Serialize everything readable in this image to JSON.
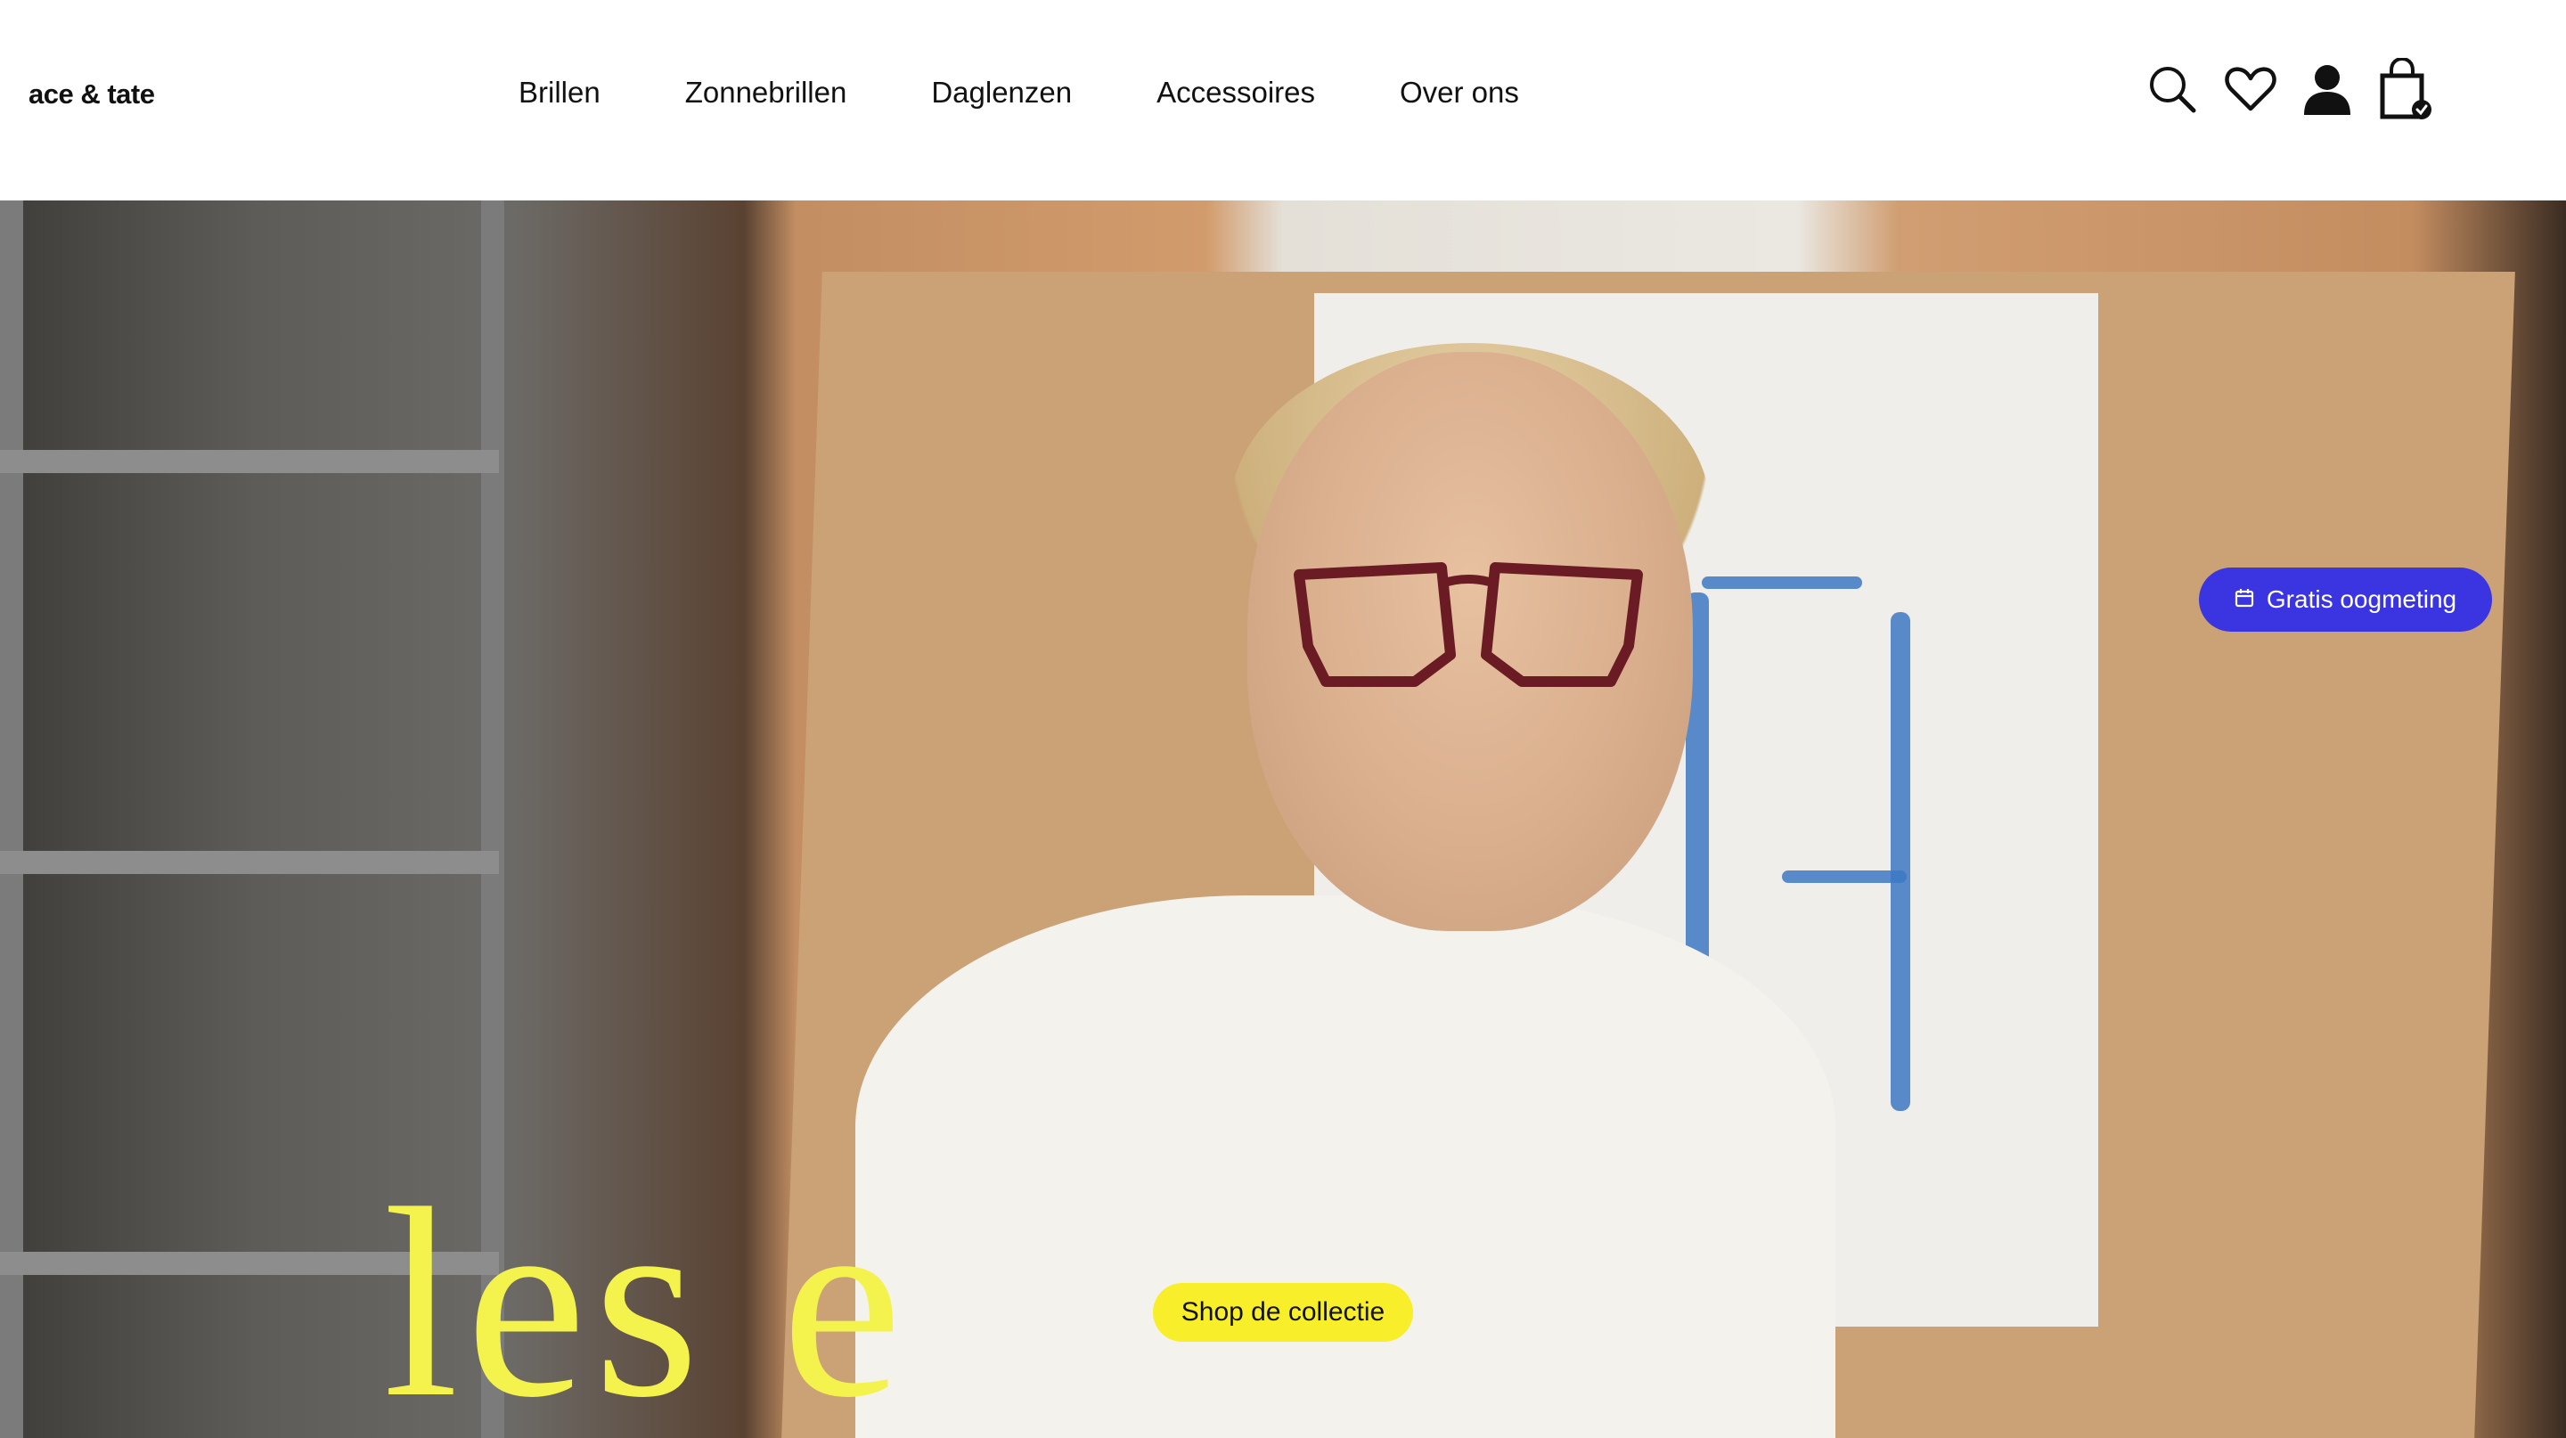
{
  "brand": {
    "logo_text": "ace & tate"
  },
  "nav": {
    "items": [
      "Brillen",
      "Zonnebrillen",
      "Daglenzen",
      "Accessoires",
      "Over ons"
    ]
  },
  "header_icons": [
    "search-icon",
    "heart-icon",
    "user-icon",
    "shopping-bag-icon"
  ],
  "hero": {
    "headline": "les e",
    "shop_button": "Shop de collectie",
    "appointment_button": "Gratis oogmeting",
    "appointment_icon": "calendar-icon"
  },
  "colors": {
    "accent_yellow": "#f8ef2a",
    "headline_yellow": "#f4f24c",
    "accent_blue": "#3a35e0",
    "text": "#111111",
    "background": "#ffffff"
  }
}
